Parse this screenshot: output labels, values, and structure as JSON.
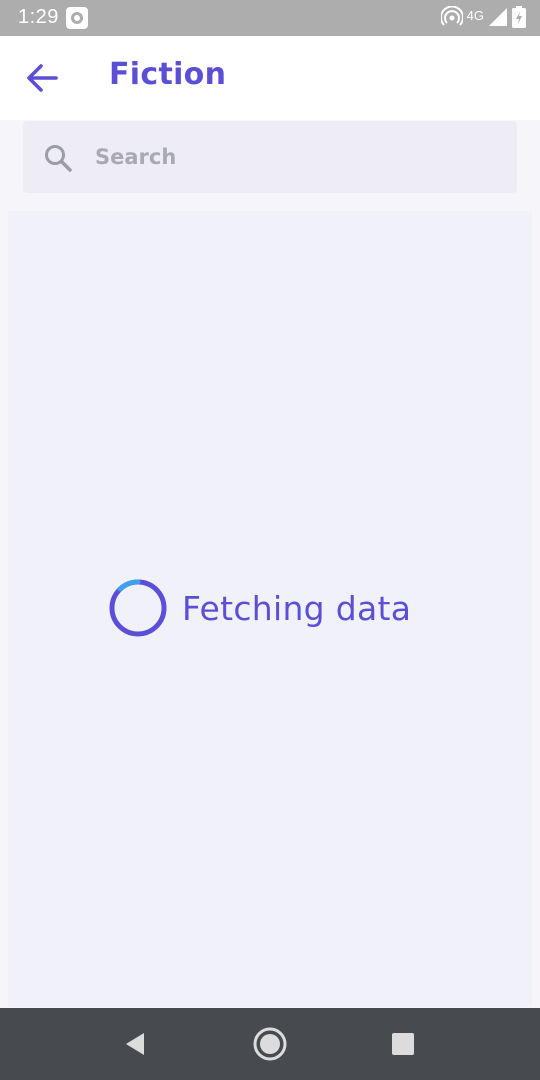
{
  "status_bar": {
    "time": "1:29",
    "network": "4G",
    "icons": [
      "notification-icon",
      "hotspot-icon",
      "signal-icon",
      "battery-icon"
    ]
  },
  "app_bar": {
    "title": "Fiction",
    "back_icon": "arrow-left-icon"
  },
  "search": {
    "placeholder": "Search",
    "value": "",
    "icon": "search-icon"
  },
  "content": {
    "loading_text": "Fetching data",
    "spinner_icon": "spinner-icon"
  },
  "nav_bar": {
    "buttons": [
      "back-icon",
      "home-icon",
      "recents-icon"
    ]
  },
  "colors": {
    "accent": "#5b4fd6",
    "spinner_highlight": "#3fa0f0",
    "status_bar": "#adadad",
    "nav_bar": "#474a4f",
    "background": "#f1f1f9"
  }
}
